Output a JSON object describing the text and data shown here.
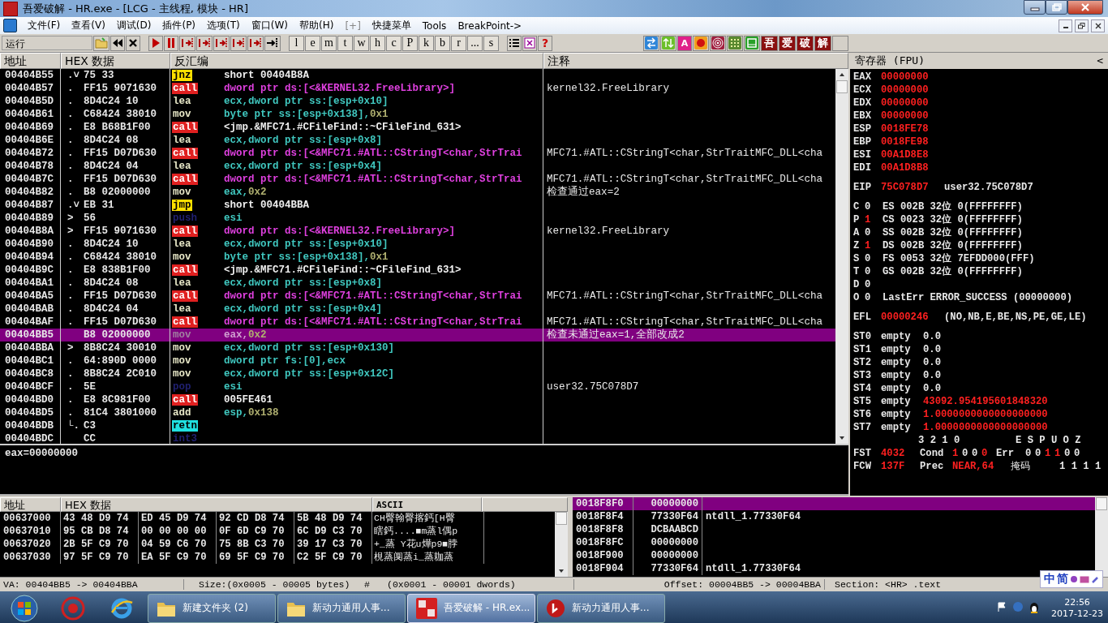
{
  "window": {
    "title": "吾爱破解 - HR.exe - [LCG -  主线程, 模块 - HR]"
  },
  "menu": [
    {
      "label": "文件(F)",
      "disabled": false
    },
    {
      "label": "查看(V)",
      "disabled": false
    },
    {
      "label": "调试(D)",
      "disabled": false
    },
    {
      "label": "插件(P)",
      "disabled": false
    },
    {
      "label": "选项(T)",
      "disabled": false
    },
    {
      "label": "窗口(W)",
      "disabled": false
    },
    {
      "label": "帮助(H)",
      "disabled": false
    },
    {
      "label": "[+]",
      "disabled": true
    },
    {
      "label": "快捷菜单",
      "disabled": false
    },
    {
      "label": "Tools",
      "disabled": false
    },
    {
      "label": "BreakPoint->",
      "disabled": false
    }
  ],
  "toolbar": {
    "status": "运行",
    "letters": [
      "l",
      "e",
      "m",
      "t",
      "w",
      "h",
      "c",
      "P",
      "k",
      "b",
      "r",
      "...",
      "s"
    ],
    "help": "?",
    "a_button": "A",
    "brand_buttons": [
      "吾",
      "爱",
      "破",
      "解"
    ]
  },
  "disasm": {
    "columns": [
      "地址",
      "HEX 数据",
      "反汇编",
      "注释"
    ],
    "rows": [
      {
        "addr": "00404B55",
        "mark": ".˅",
        "hex": "75 33",
        "mnemonic": "jnz",
        "kind": "jcc",
        "operand": {
          "kind": "jump",
          "text": "short 00404B8A"
        },
        "selected": false
      },
      {
        "addr": "00404B57",
        "mark": ".",
        "hex": "FF15 9071630",
        "mnemonic": "call",
        "kind": "call",
        "operand": {
          "kind": "api",
          "text": "dword ptr ds:[<&KERNEL32.FreeLibrary>]"
        },
        "comment": "kernel32.FreeLibrary",
        "selected": false
      },
      {
        "addr": "00404B5D",
        "mark": ".",
        "hex": "8D4C24 10",
        "mnemonic": "lea",
        "kind": "plain",
        "operand": {
          "kind": "mem",
          "text": "ecx,dword ptr ss:[esp+0x10]"
        },
        "selected": false
      },
      {
        "addr": "00404B61",
        "mark": ".",
        "hex": "C68424 38010",
        "mnemonic": "mov",
        "kind": "plain",
        "operand": {
          "kind": "mem",
          "text": "byte ptr ss:[esp+0x138],",
          "imm": "0x1"
        },
        "selected": false
      },
      {
        "addr": "00404B69",
        "mark": ".",
        "hex": "E8 B68B1F00",
        "mnemonic": "call",
        "kind": "call",
        "operand": {
          "kind": "jump",
          "text": "<jmp.&MFC71.#CFileFind::~CFileFind_631>"
        },
        "selected": false
      },
      {
        "addr": "00404B6E",
        "mark": ".",
        "hex": "8D4C24 08",
        "mnemonic": "lea",
        "kind": "plain",
        "operand": {
          "kind": "mem",
          "text": "ecx,dword ptr ss:[esp+0x8]"
        },
        "selected": false
      },
      {
        "addr": "00404B72",
        "mark": ".",
        "hex": "FF15 D07D630",
        "mnemonic": "call",
        "kind": "call",
        "operand": {
          "kind": "api",
          "text": "dword ptr ds:[<&MFC71.#ATL::CStringT<char,StrTrai"
        },
        "comment": "MFC71.#ATL::CStringT<char,StrTraitMFC_DLL<cha",
        "selected": false
      },
      {
        "addr": "00404B78",
        "mark": ".",
        "hex": "8D4C24 04",
        "mnemonic": "lea",
        "kind": "plain",
        "operand": {
          "kind": "mem",
          "text": "ecx,dword ptr ss:[esp+0x4]"
        },
        "selected": false
      },
      {
        "addr": "00404B7C",
        "mark": ".",
        "hex": "FF15 D07D630",
        "mnemonic": "call",
        "kind": "call",
        "operand": {
          "kind": "api",
          "text": "dword ptr ds:[<&MFC71.#ATL::CStringT<char,StrTrai"
        },
        "comment": "MFC71.#ATL::CStringT<char,StrTraitMFC_DLL<cha",
        "selected": false
      },
      {
        "addr": "00404B82",
        "mark": ".",
        "hex": "B8 02000000",
        "mnemonic": "mov",
        "kind": "plain",
        "operand": {
          "kind": "mem",
          "text": "eax,",
          "imm": "0x2"
        },
        "comment": "检查通过eax=2",
        "selected": false
      },
      {
        "addr": "00404B87",
        "mark": ".˅",
        "hex": "EB 31",
        "mnemonic": "jmp",
        "kind": "jcc",
        "operand": {
          "kind": "jump",
          "text": "short 00404BBA"
        },
        "selected": false
      },
      {
        "addr": "00404B89",
        "mark": ">",
        "hex": "56",
        "mnemonic": "push",
        "kind": "stack",
        "operand": {
          "kind": "mem",
          "text": "esi"
        },
        "selected": false
      },
      {
        "addr": "00404B8A",
        "mark": ">",
        "hex": "FF15 9071630",
        "mnemonic": "call",
        "kind": "call",
        "operand": {
          "kind": "api",
          "text": "dword ptr ds:[<&KERNEL32.FreeLibrary>]"
        },
        "comment": "kernel32.FreeLibrary",
        "selected": false
      },
      {
        "addr": "00404B90",
        "mark": ".",
        "hex": "8D4C24 10",
        "mnemonic": "lea",
        "kind": "plain",
        "operand": {
          "kind": "mem",
          "text": "ecx,dword ptr ss:[esp+0x10]"
        },
        "selected": false
      },
      {
        "addr": "00404B94",
        "mark": ".",
        "hex": "C68424 38010",
        "mnemonic": "mov",
        "kind": "plain",
        "operand": {
          "kind": "mem",
          "text": "byte ptr ss:[esp+0x138],",
          "imm": "0x1"
        },
        "selected": false
      },
      {
        "addr": "00404B9C",
        "mark": ".",
        "hex": "E8 838B1F00",
        "mnemonic": "call",
        "kind": "call",
        "operand": {
          "kind": "jump",
          "text": "<jmp.&MFC71.#CFileFind::~CFileFind_631>"
        },
        "selected": false
      },
      {
        "addr": "00404BA1",
        "mark": ".",
        "hex": "8D4C24 08",
        "mnemonic": "lea",
        "kind": "plain",
        "operand": {
          "kind": "mem",
          "text": "ecx,dword ptr ss:[esp+0x8]"
        },
        "selected": false
      },
      {
        "addr": "00404BA5",
        "mark": ".",
        "hex": "FF15 D07D630",
        "mnemonic": "call",
        "kind": "call",
        "operand": {
          "kind": "api",
          "text": "dword ptr ds:[<&MFC71.#ATL::CStringT<char,StrTrai"
        },
        "comment": "MFC71.#ATL::CStringT<char,StrTraitMFC_DLL<cha",
        "selected": false
      },
      {
        "addr": "00404BAB",
        "mark": ".",
        "hex": "8D4C24 04",
        "mnemonic": "lea",
        "kind": "plain",
        "operand": {
          "kind": "mem",
          "text": "ecx,dword ptr ss:[esp+0x4]"
        },
        "selected": false
      },
      {
        "addr": "00404BAF",
        "mark": ".",
        "hex": "FF15 D07D630",
        "mnemonic": "call",
        "kind": "call",
        "operand": {
          "kind": "api",
          "text": "dword ptr ds:[<&MFC71.#ATL::CStringT<char,StrTrai"
        },
        "comment": "MFC71.#ATL::CStringT<char,StrTraitMFC_DLL<cha",
        "selected": false
      },
      {
        "addr": "00404BB5",
        "hex": "B8 02000000",
        "mnemonic": "mov",
        "kind": "plain",
        "operand": {
          "kind": "mem",
          "text": "eax,",
          "imm": "0x2"
        },
        "comment": "检查未通过eax=1,全部改成2",
        "selected": true
      },
      {
        "addr": "00404BBA",
        "mark": ">",
        "hex": "8B8C24 30010",
        "mnemonic": "mov",
        "kind": "plain",
        "operand": {
          "kind": "mem",
          "text": "ecx,dword ptr ss:[esp+0x130]"
        },
        "selected": false
      },
      {
        "addr": "00404BC1",
        "mark": ".",
        "hex": "64:890D 0000",
        "mnemonic": "mov",
        "kind": "plain",
        "operand": {
          "kind": "mem",
          "text": "dword ptr fs:[0],ecx"
        },
        "selected": false
      },
      {
        "addr": "00404BC8",
        "mark": ".",
        "hex": "8B8C24 2C010",
        "mnemonic": "mov",
        "kind": "plain",
        "operand": {
          "kind": "mem",
          "text": "ecx,dword ptr ss:[esp+0x12C]"
        },
        "selected": false
      },
      {
        "addr": "00404BCF",
        "mark": ".",
        "hex": "5E",
        "mnemonic": "pop",
        "kind": "stack",
        "operand": {
          "kind": "mem",
          "text": "esi"
        },
        "comment": "user32.75C078D7",
        "selected": false
      },
      {
        "addr": "00404BD0",
        "mark": ".",
        "hex": "E8 8C981F00",
        "mnemonic": "call",
        "kind": "call",
        "operand": {
          "kind": "jump",
          "text": "005FE461"
        },
        "selected": false
      },
      {
        "addr": "00404BD5",
        "mark": ".",
        "hex": "81C4 3801000",
        "mnemonic": "add",
        "kind": "plain",
        "operand": {
          "kind": "mem",
          "text": "esp,",
          "imm": "0x138"
        },
        "selected": false
      },
      {
        "addr": "00404BDB",
        "mark": "└.",
        "hex": "C3",
        "mnemonic": "retn",
        "kind": "ret",
        "selected": false
      },
      {
        "addr": "00404BDC",
        "hex": "CC",
        "mnemonic": "int3",
        "kind": "stack",
        "selected": false
      }
    ],
    "info": "eax=00000000"
  },
  "registers": {
    "title": "寄存器 (FPU)",
    "collapse": "<",
    "general": [
      {
        "name": "EAX",
        "value": "00000000",
        "changed": true
      },
      {
        "name": "ECX",
        "value": "00000000",
        "changed": true
      },
      {
        "name": "EDX",
        "value": "00000000",
        "changed": true
      },
      {
        "name": "EBX",
        "value": "00000000",
        "changed": true
      },
      {
        "name": "ESP",
        "value": "0018FE78",
        "changed": true
      },
      {
        "name": "EBP",
        "value": "0018FE98",
        "changed": true
      },
      {
        "name": "ESI",
        "value": "00A1D8E8",
        "changed": true
      },
      {
        "name": "EDI",
        "value": "00A1D8B8",
        "changed": true
      }
    ],
    "eip": {
      "name": "EIP",
      "value": "75C078D7",
      "changed": true,
      "info": "user32.75C078D7"
    },
    "flags": [
      {
        "flag": "C",
        "value": "0",
        "changed": false,
        "segment": "ES 002B 32位 0(FFFFFFFF)"
      },
      {
        "flag": "P",
        "value": "1",
        "changed": true,
        "segment": "CS 0023 32位 0(FFFFFFFF)"
      },
      {
        "flag": "A",
        "value": "0",
        "changed": false,
        "segment": "SS 002B 32位 0(FFFFFFFF)"
      },
      {
        "flag": "Z",
        "value": "1",
        "changed": true,
        "segment": "DS 002B 32位 0(FFFFFFFF)"
      },
      {
        "flag": "S",
        "value": "0",
        "changed": false,
        "segment": "FS 0053 32位 7EFDD000(FFF)"
      },
      {
        "flag": "T",
        "value": "0",
        "changed": false,
        "segment": "GS 002B 32位 0(FFFFFFFF)"
      },
      {
        "flag": "D",
        "value": "0",
        "changed": false
      },
      {
        "flag": "O",
        "value": "0",
        "changed": false,
        "segment": "LastErr ERROR_SUCCESS (00000000)"
      }
    ],
    "efl": {
      "name": "EFL",
      "value": "00000246",
      "changed": true,
      "info": "(NO,NB,E,BE,NS,PE,GE,LE)"
    },
    "fpu": [
      {
        "name": "ST0",
        "tag": "empty",
        "value": "0.0",
        "changed": false
      },
      {
        "name": "ST1",
        "tag": "empty",
        "value": "0.0",
        "changed": false
      },
      {
        "name": "ST2",
        "tag": "empty",
        "value": "0.0",
        "changed": false
      },
      {
        "name": "ST3",
        "tag": "empty",
        "value": "0.0",
        "changed": false
      },
      {
        "name": "ST4",
        "tag": "empty",
        "value": "0.0",
        "changed": false
      },
      {
        "name": "ST5",
        "tag": "empty",
        "value": "43092.954195601848320",
        "changed": true
      },
      {
        "name": "ST6",
        "tag": "empty",
        "value": "1.0000000000000000000",
        "changed": true
      },
      {
        "name": "ST7",
        "tag": "empty",
        "value": "1.0000000000000000000",
        "changed": true
      }
    ],
    "status_header": {
      "cond": "3 2 1 0",
      "err": "E S P U O Z"
    },
    "fst": {
      "name": "FST",
      "value": "4032",
      "cond_label": "Cond",
      "cond": [
        {
          "v": "1",
          "changed": true
        },
        {
          "v": "0",
          "changed": false
        },
        {
          "v": "0",
          "changed": false
        },
        {
          "v": "0",
          "changed": true
        }
      ],
      "err_label": "Err",
      "err": [
        {
          "v": "0",
          "changed": false
        },
        {
          "v": "0",
          "changed": false
        },
        {
          "v": "1",
          "changed": true
        },
        {
          "v": "1",
          "changed": true
        },
        {
          "v": "0",
          "changed": false
        },
        {
          "v": "0",
          "changed": false
        }
      ]
    },
    "fcw": {
      "name": "FCW",
      "value": "137F",
      "prec_label": "Prec",
      "prec": "NEAR,64",
      "mask_label": "掩码",
      "mask": "1 1 1 1"
    }
  },
  "dump": {
    "columns": [
      "地址",
      "HEX 数据",
      "ASCII"
    ],
    "rows": [
      {
        "addr": "00637000",
        "hex": [
          "43 48 D9 74",
          "ED 45 D9 74",
          "92 CD D8 74",
          "5B 48 D9 74"
        ],
        "ascii": "CH臀翰臀揢鈣[H臀"
      },
      {
        "addr": "00637010",
        "hex": [
          "95 CB D8 74",
          "00 00 00 00",
          "0F 6D C9 70",
          "6C D9 C3 70"
        ],
        "ascii": "瞎鈣....■m蒸l偶p"
      },
      {
        "addr": "00637020",
        "hex": [
          "2B 5F C9 70",
          "04 59 C6 70",
          "75 8B C3 70",
          "39 17 C3 70"
        ],
        "ascii": "+_蒸 Y花u燁p9■脖"
      },
      {
        "addr": "00637030",
        "hex": [
          "97 5F C9 70",
          "EA 5F C9 70",
          "69 5F C9 70",
          "C2 5F C9 70"
        ],
        "ascii": "梘蒸阒蒸i_蒸耞蒸"
      }
    ]
  },
  "stack": [
    {
      "addr": "0018F8F0",
      "value": "00000000",
      "selected": true
    },
    {
      "addr": "0018F8F4",
      "value": "77330F64",
      "comment": "ntdll_1.77330F64",
      "selected": false
    },
    {
      "addr": "0018F8F8",
      "value": "DCBAABCD",
      "selected": false
    },
    {
      "addr": "0018F8FC",
      "value": "00000000",
      "selected": false
    },
    {
      "addr": "0018F900",
      "value": "00000000",
      "selected": false
    },
    {
      "addr": "0018F904",
      "value": "77330F64",
      "comment": "ntdll_1.77330F64",
      "selected": false
    }
  ],
  "status_bar": [
    "VA: 00404BB5 -> 00404BBA",
    "Size:(0x0005 - 00005 bytes)",
    "#",
    "(0x0001 - 00001 dwords)",
    "Offset: 00004BB5 -> 00004BBA",
    "Section: <HR> .text"
  ],
  "taskbar": {
    "tasks": [
      {
        "label": "新建文件夹 (2)",
        "kind": "folder",
        "selected": false
      },
      {
        "label": "新动力通用人事...",
        "kind": "folder",
        "selected": false
      },
      {
        "label": "吾爱破解 - HR.ex...",
        "kind": "debugger",
        "selected": true
      },
      {
        "label": "新动力通用人事...",
        "kind": "app",
        "selected": false
      }
    ],
    "ime": [
      "中",
      "简"
    ],
    "time": "22:56",
    "date": "2017-12-23"
  }
}
